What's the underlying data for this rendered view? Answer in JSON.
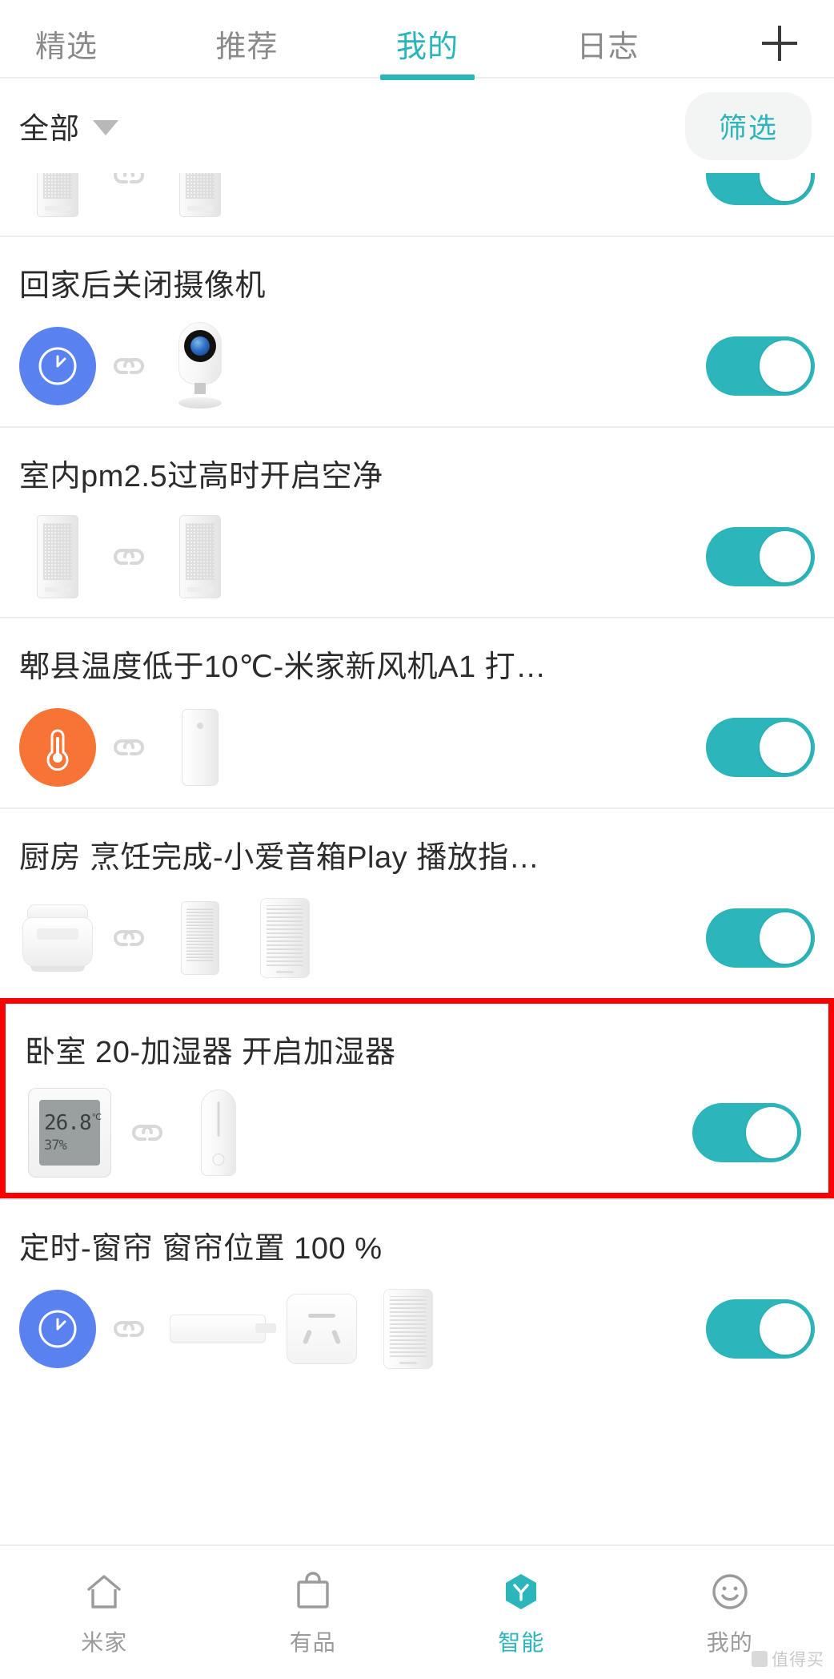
{
  "top_tabs": {
    "items": [
      {
        "label": "精选",
        "active": false
      },
      {
        "label": "推荐",
        "active": false
      },
      {
        "label": "我的",
        "active": true
      },
      {
        "label": "日志",
        "active": false
      }
    ],
    "add_icon": "plus-icon",
    "active_color": "#2cb5bb",
    "inactive_color": "#8a8a8a"
  },
  "filter_bar": {
    "scope_label": "全部",
    "scope_caret_icon": "chevron-down-icon",
    "filter_button_label": "筛选",
    "filter_button_color": "#2cb5bb",
    "filter_button_bg": "#f3f4f4"
  },
  "automations": [
    {
      "title": "",
      "clipped": true,
      "devices": [
        "air-purifier",
        "chain-link",
        "air-purifier"
      ],
      "enabled": true
    },
    {
      "title": "回家后关闭摄像机",
      "clipped": false,
      "devices": [
        "clock-circle-blue",
        "chain-link",
        "camera"
      ],
      "enabled": true
    },
    {
      "title": "室内pm2.5过高时开启空净",
      "clipped": false,
      "devices": [
        "air-purifier",
        "chain-link",
        "air-purifier"
      ],
      "enabled": true
    },
    {
      "title": "郫县温度低于10℃-米家新风机A1 打…",
      "clipped": false,
      "devices": [
        "thermometer-circle-orange",
        "chain-link",
        "fresh-air-fan"
      ],
      "enabled": true
    },
    {
      "title": "厨房 烹饪完成-小爱音箱Play 播放指…",
      "clipped": false,
      "devices": [
        "rice-cooker",
        "chain-link",
        "mesh-purifier",
        "smart-speaker"
      ],
      "enabled": true
    },
    {
      "title": "卧室 20-加湿器 开启加湿器",
      "clipped": false,
      "highlighted": true,
      "highlight_color": "#fb0000",
      "devices": [
        "temp-humidity-sensor",
        "chain-link",
        "humidifier"
      ],
      "enabled": true,
      "sensor_reading": {
        "temperature": "26.8",
        "temperature_unit": "℃",
        "humidity": "37",
        "humidity_unit": "%"
      }
    },
    {
      "title": "定时-窗帘 窗帘位置 100 %",
      "clipped": false,
      "devices": [
        "clock-circle-blue",
        "chain-link",
        "curtain-motor",
        "wall-socket",
        "smart-speaker"
      ],
      "enabled": true
    }
  ],
  "toggle": {
    "state": "on",
    "on_color": "#2cb5bb",
    "knob_color": "#ffffff"
  },
  "bottom_nav": {
    "items": [
      {
        "label": "米家",
        "icon": "home-icon",
        "active": false
      },
      {
        "label": "有品",
        "icon": "shopping-bag-icon",
        "active": false
      },
      {
        "label": "智能",
        "icon": "smart-hexagon-icon",
        "active": true
      },
      {
        "label": "我的",
        "icon": "smiley-face-icon",
        "active": false
      }
    ],
    "active_color": "#2cb5bb",
    "inactive_color": "#9b9b9b"
  },
  "watermark": {
    "text": "值得买"
  }
}
